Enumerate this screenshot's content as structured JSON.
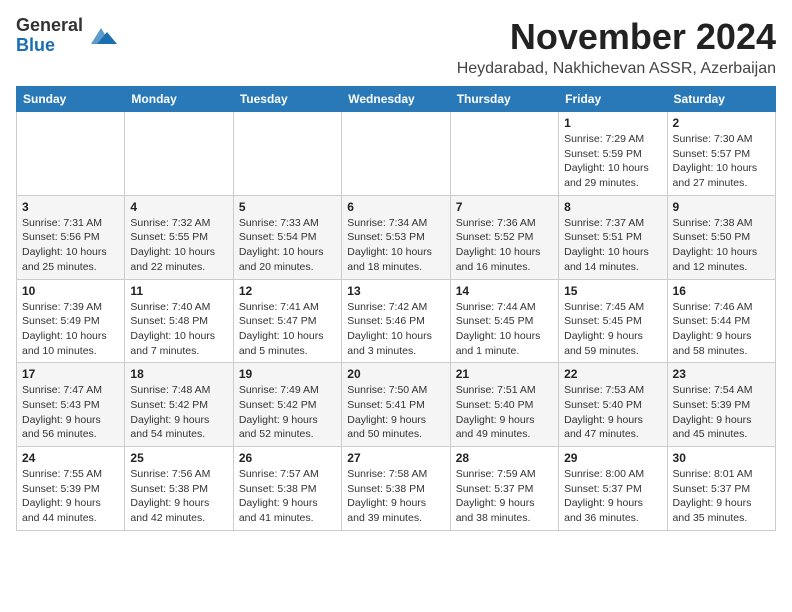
{
  "header": {
    "logo_line1": "General",
    "logo_line2": "Blue",
    "month_title": "November 2024",
    "location": "Heydarabad, Nakhichevan ASSR, Azerbaijan"
  },
  "weekdays": [
    "Sunday",
    "Monday",
    "Tuesday",
    "Wednesday",
    "Thursday",
    "Friday",
    "Saturday"
  ],
  "weeks": [
    [
      {
        "day": "",
        "info": ""
      },
      {
        "day": "",
        "info": ""
      },
      {
        "day": "",
        "info": ""
      },
      {
        "day": "",
        "info": ""
      },
      {
        "day": "",
        "info": ""
      },
      {
        "day": "1",
        "info": "Sunrise: 7:29 AM\nSunset: 5:59 PM\nDaylight: 10 hours\nand 29 minutes."
      },
      {
        "day": "2",
        "info": "Sunrise: 7:30 AM\nSunset: 5:57 PM\nDaylight: 10 hours\nand 27 minutes."
      }
    ],
    [
      {
        "day": "3",
        "info": "Sunrise: 7:31 AM\nSunset: 5:56 PM\nDaylight: 10 hours\nand 25 minutes."
      },
      {
        "day": "4",
        "info": "Sunrise: 7:32 AM\nSunset: 5:55 PM\nDaylight: 10 hours\nand 22 minutes."
      },
      {
        "day": "5",
        "info": "Sunrise: 7:33 AM\nSunset: 5:54 PM\nDaylight: 10 hours\nand 20 minutes."
      },
      {
        "day": "6",
        "info": "Sunrise: 7:34 AM\nSunset: 5:53 PM\nDaylight: 10 hours\nand 18 minutes."
      },
      {
        "day": "7",
        "info": "Sunrise: 7:36 AM\nSunset: 5:52 PM\nDaylight: 10 hours\nand 16 minutes."
      },
      {
        "day": "8",
        "info": "Sunrise: 7:37 AM\nSunset: 5:51 PM\nDaylight: 10 hours\nand 14 minutes."
      },
      {
        "day": "9",
        "info": "Sunrise: 7:38 AM\nSunset: 5:50 PM\nDaylight: 10 hours\nand 12 minutes."
      }
    ],
    [
      {
        "day": "10",
        "info": "Sunrise: 7:39 AM\nSunset: 5:49 PM\nDaylight: 10 hours\nand 10 minutes."
      },
      {
        "day": "11",
        "info": "Sunrise: 7:40 AM\nSunset: 5:48 PM\nDaylight: 10 hours\nand 7 minutes."
      },
      {
        "day": "12",
        "info": "Sunrise: 7:41 AM\nSunset: 5:47 PM\nDaylight: 10 hours\nand 5 minutes."
      },
      {
        "day": "13",
        "info": "Sunrise: 7:42 AM\nSunset: 5:46 PM\nDaylight: 10 hours\nand 3 minutes."
      },
      {
        "day": "14",
        "info": "Sunrise: 7:44 AM\nSunset: 5:45 PM\nDaylight: 10 hours\nand 1 minute."
      },
      {
        "day": "15",
        "info": "Sunrise: 7:45 AM\nSunset: 5:45 PM\nDaylight: 9 hours\nand 59 minutes."
      },
      {
        "day": "16",
        "info": "Sunrise: 7:46 AM\nSunset: 5:44 PM\nDaylight: 9 hours\nand 58 minutes."
      }
    ],
    [
      {
        "day": "17",
        "info": "Sunrise: 7:47 AM\nSunset: 5:43 PM\nDaylight: 9 hours\nand 56 minutes."
      },
      {
        "day": "18",
        "info": "Sunrise: 7:48 AM\nSunset: 5:42 PM\nDaylight: 9 hours\nand 54 minutes."
      },
      {
        "day": "19",
        "info": "Sunrise: 7:49 AM\nSunset: 5:42 PM\nDaylight: 9 hours\nand 52 minutes."
      },
      {
        "day": "20",
        "info": "Sunrise: 7:50 AM\nSunset: 5:41 PM\nDaylight: 9 hours\nand 50 minutes."
      },
      {
        "day": "21",
        "info": "Sunrise: 7:51 AM\nSunset: 5:40 PM\nDaylight: 9 hours\nand 49 minutes."
      },
      {
        "day": "22",
        "info": "Sunrise: 7:53 AM\nSunset: 5:40 PM\nDaylight: 9 hours\nand 47 minutes."
      },
      {
        "day": "23",
        "info": "Sunrise: 7:54 AM\nSunset: 5:39 PM\nDaylight: 9 hours\nand 45 minutes."
      }
    ],
    [
      {
        "day": "24",
        "info": "Sunrise: 7:55 AM\nSunset: 5:39 PM\nDaylight: 9 hours\nand 44 minutes."
      },
      {
        "day": "25",
        "info": "Sunrise: 7:56 AM\nSunset: 5:38 PM\nDaylight: 9 hours\nand 42 minutes."
      },
      {
        "day": "26",
        "info": "Sunrise: 7:57 AM\nSunset: 5:38 PM\nDaylight: 9 hours\nand 41 minutes."
      },
      {
        "day": "27",
        "info": "Sunrise: 7:58 AM\nSunset: 5:38 PM\nDaylight: 9 hours\nand 39 minutes."
      },
      {
        "day": "28",
        "info": "Sunrise: 7:59 AM\nSunset: 5:37 PM\nDaylight: 9 hours\nand 38 minutes."
      },
      {
        "day": "29",
        "info": "Sunrise: 8:00 AM\nSunset: 5:37 PM\nDaylight: 9 hours\nand 36 minutes."
      },
      {
        "day": "30",
        "info": "Sunrise: 8:01 AM\nSunset: 5:37 PM\nDaylight: 9 hours\nand 35 minutes."
      }
    ]
  ]
}
